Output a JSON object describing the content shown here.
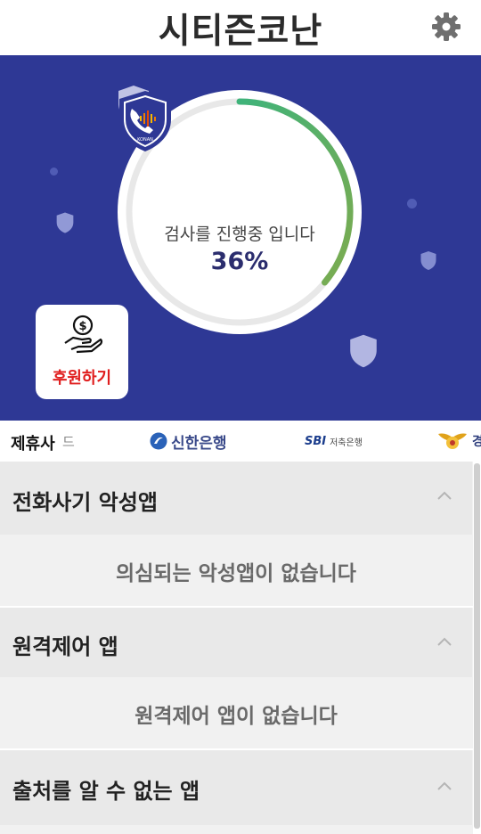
{
  "header": {
    "title": "시티즌코난",
    "settings_icon": "gear-icon"
  },
  "scan": {
    "status_text": "검사를 진행중 입니다",
    "progress_label": "36%",
    "progress_fraction": 0.36,
    "brand_icon": "phone-shield-icon",
    "brand_text": "KONAN"
  },
  "donate": {
    "label": "후원하기",
    "icon": "money-hand-icon"
  },
  "partners": {
    "label": "제휴사",
    "fragment": "드",
    "items": [
      {
        "name": "신한은행",
        "icon": "shinhan-logo-icon"
      },
      {
        "mark": "SBI",
        "name": "저축은행"
      },
      {
        "name": "경",
        "icon": "police-emblem-icon"
      }
    ]
  },
  "sections": [
    {
      "title": "전화사기 악성앱",
      "message": "의심되는 악성앱이 없습니다"
    },
    {
      "title": "원격제어 앱",
      "message": "원격제어 앱이 없습니다"
    },
    {
      "title": "출처를 알 수 없는 앱",
      "message": ""
    }
  ],
  "colors": {
    "hero_background": "#2e3895",
    "progress_start": "#3fb37a",
    "progress_end": "#7cab4f",
    "donate_text": "#e01e1e"
  }
}
